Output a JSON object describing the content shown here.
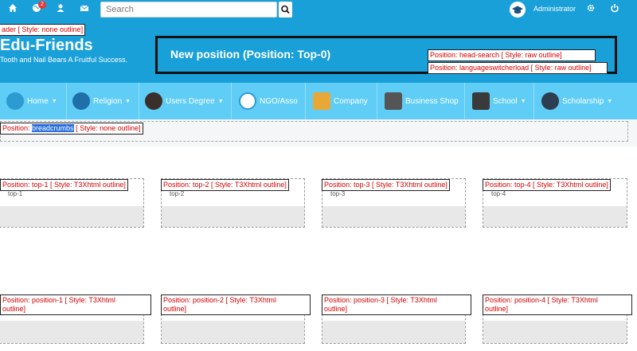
{
  "topbar": {
    "icons": [
      "home-icon",
      "globe-icon",
      "user-icon",
      "mail-icon"
    ],
    "notification_count": "2",
    "search_placeholder": "Search",
    "admin_name": "Administrator"
  },
  "header": {
    "header_label": "ader [ Style: none outline]",
    "site_name": "Edu-Friends",
    "slogan": "Tooth and Nail Bears A Fruitful Success.",
    "new_position_title": "New position (Position: Top-0)",
    "head_search_label": "Position: head-search [ Style: raw outline]",
    "language_label": "Position: languageswitcherload [ Style: raw outline]"
  },
  "nav": {
    "items": [
      {
        "label": "Home",
        "dropdown": true
      },
      {
        "label": "Religion",
        "dropdown": true
      },
      {
        "label": "Users Degree",
        "dropdown": true
      },
      {
        "label": "NGO/Asso",
        "dropdown": false
      },
      {
        "label": "Company",
        "dropdown": false
      },
      {
        "label": "Business Shop",
        "dropdown": false
      },
      {
        "label": "School",
        "dropdown": true
      },
      {
        "label": "Scholarship",
        "dropdown": true
      }
    ]
  },
  "breadcrumbs": {
    "prefix": "Position: ",
    "highlight": "breadcrumbs",
    "suffix": " [ Style: none outline]"
  },
  "top_modules": [
    {
      "label": "Position: top-1 [ Style: T3Xhtml outline]",
      "content": "top-1"
    },
    {
      "label": "Position: top-2 [ Style: T3Xhtml outline]",
      "content": "top-2"
    },
    {
      "label": "Position: top-3 [ Style: T3Xhtml outline]",
      "content": "top-3"
    },
    {
      "label": "Position: top-4 [ Style: T3Xhtml outline]",
      "content": "top-4"
    }
  ],
  "position_modules": [
    {
      "label_line1": "Position: position-1 [ Style: T3Xhtml",
      "label_line2": "outline]"
    },
    {
      "label_line1": "Position: position-2 [ Style: T3Xhtml",
      "label_line2": "outline]"
    },
    {
      "label_line1": "Position: position-3 [ Style: T3Xhtml",
      "label_line2": "outline]"
    },
    {
      "label_line1": "Position: position-4 [ Style: T3Xhtml",
      "label_line2": "outline]"
    }
  ],
  "colors": {
    "brand_blue": "#1aa0d8",
    "nav_blue": "#5fcdf5",
    "label_red": "#d40000",
    "highlight_blue": "#2a6fdb"
  }
}
